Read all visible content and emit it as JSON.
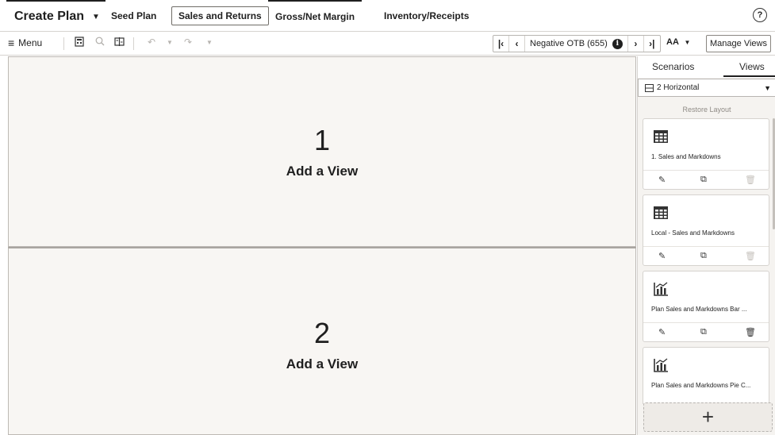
{
  "topbar": {
    "tabs": [
      {
        "label": "Create Plan"
      },
      {
        "label": "Seed Plan"
      },
      {
        "label": "Sales and Returns"
      },
      {
        "label": "Gross/Net Margin"
      },
      {
        "label": "Inventory/Receipts"
      }
    ],
    "help_glyph": "?"
  },
  "toolbar": {
    "menu_label": "Menu",
    "nav_label": "Negative OTB (655)",
    "info_glyph": "i",
    "font_label": "AA",
    "manage_views_label": "Manage Views"
  },
  "main": {
    "panes": [
      {
        "number": "1",
        "label": "Add a View"
      },
      {
        "number": "2",
        "label": "Add a View"
      }
    ]
  },
  "rpanel": {
    "tabs": [
      {
        "label": "Scenarios"
      },
      {
        "label": "Views",
        "selected": true
      }
    ],
    "layout_value": "2 Horizontal",
    "restore_label": "Restore Layout",
    "cards": [
      {
        "title": "1. Sales and Markdowns",
        "icon": "table-icon",
        "delete_enabled": false
      },
      {
        "title": "Local - Sales and Markdowns",
        "icon": "table-icon",
        "delete_enabled": false
      },
      {
        "title": "Plan Sales and Markdowns Bar ...",
        "icon": "bar-chart-icon",
        "delete_enabled": true
      },
      {
        "title": "Plan Sales and Markdowns Pie C...",
        "icon": "bar-chart-icon",
        "delete_enabled": true
      }
    ],
    "add_glyph": "+"
  }
}
